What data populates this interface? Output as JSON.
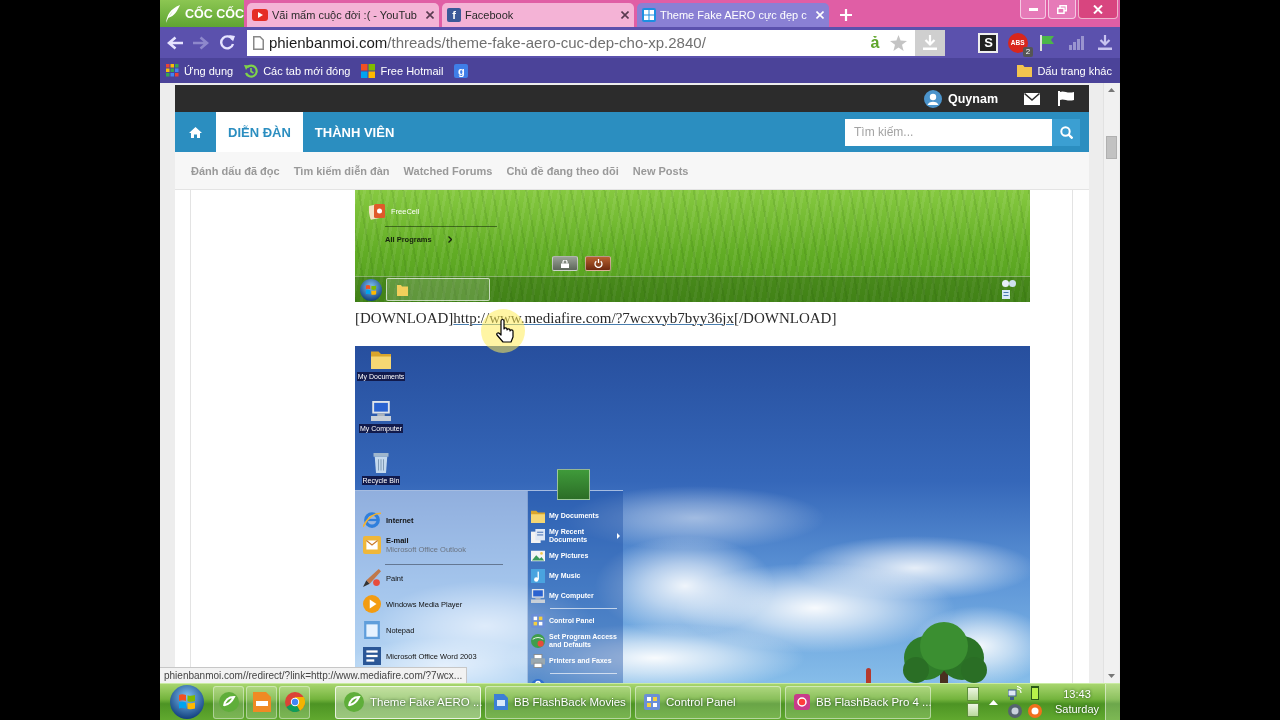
{
  "browser": {
    "logo": "CỐC CỐC",
    "tabs": [
      {
        "kind": "youtube",
        "title": "Vãi mấm cuộc đời :( - YouTub",
        "selected": false
      },
      {
        "kind": "facebook",
        "favicon": "f",
        "title": "Facebook",
        "selected": false
      },
      {
        "kind": "windows",
        "title": "Theme Fake AERO cực đẹp c",
        "selected": true
      }
    ],
    "address": {
      "domain": "phienbanmoi.com",
      "path": "/threads/theme-fake-aero-cuc-dep-cho-xp.2840/"
    },
    "typing_indicator": "ả",
    "extensions": [
      {
        "kind": "download_tile"
      },
      {
        "kind": "s_box",
        "label": "S"
      },
      {
        "kind": "abs",
        "label": "ABS",
        "badge": "2"
      },
      {
        "kind": "flag"
      },
      {
        "kind": "bars"
      },
      {
        "kind": "download"
      }
    ],
    "bookmarks": [
      {
        "kind": "apps",
        "label": "Ứng dụng"
      },
      {
        "kind": "recent",
        "label": "Các tab mới đóng"
      },
      {
        "kind": "windows",
        "label": "Free Hotmail"
      },
      {
        "kind": "google",
        "label": "g"
      }
    ],
    "other_bookmarks": "Dấu trang khác"
  },
  "forum": {
    "user": "Quynam",
    "nav_tabs": [
      {
        "kind": "home",
        "selected": false
      },
      {
        "kind": "text",
        "label": "DIỄN ĐÀN",
        "selected": true
      },
      {
        "kind": "text",
        "label": "THÀNH VIÊN",
        "selected": false
      }
    ],
    "search": {
      "placeholder": "Tìm kiếm..."
    },
    "sub_nav": [
      "Đánh dấu đã đọc",
      "Tìm kiếm diễn đàn",
      "Watched Forums",
      "Chủ đề đang theo dõi",
      "New Posts"
    ]
  },
  "post": {
    "screenshot_1": {
      "menu_items": [
        "FreeCell"
      ],
      "all_programs": "All Programs"
    },
    "download_line": {
      "prefix": "[DOWNLOAD]",
      "link": "http://www.mediafire.com/?7wcxvyb7byy36jx",
      "suffix": "[/DOWNLOAD]"
    },
    "screenshot_2": {
      "desktop_icons": [
        {
          "kind": "folder",
          "label": "My Documents"
        },
        {
          "kind": "computer",
          "label": "My Computer"
        },
        {
          "kind": "bin",
          "label": "Recycle Bin"
        }
      ],
      "start_left": [
        {
          "kind": "ie",
          "label": "Internet"
        },
        {
          "kind": "mail",
          "label": "E-mail",
          "subtitle": "Microsoft Office Outlook"
        },
        {
          "kind": "separator"
        },
        {
          "kind": "paint",
          "label": "Paint"
        },
        {
          "kind": "media",
          "label": "Windows Media Player"
        },
        {
          "kind": "notepad",
          "label": "Notepad"
        },
        {
          "kind": "word",
          "label": "Microsoft Office Word 2003"
        }
      ],
      "start_right": [
        {
          "kind": "folder",
          "label": "My Documents",
          "submenu": false
        },
        {
          "kind": "recent",
          "label": "My Recent Documents",
          "submenu": true
        },
        {
          "kind": "pictures",
          "label": "My Pictures",
          "submenu": false
        },
        {
          "kind": "music",
          "label": "My Music",
          "submenu": false
        },
        {
          "kind": "computer",
          "label": "My Computer",
          "submenu": false
        },
        {
          "kind": "separator"
        },
        {
          "kind": "control",
          "label": "Control Panel",
          "submenu": false
        },
        {
          "kind": "defaults",
          "label": "Set Program Access and Defaults",
          "submenu": false
        },
        {
          "kind": "printer",
          "label": "Printers and Faxes",
          "submenu": false
        },
        {
          "kind": "separator"
        },
        {
          "kind": "help"
        }
      ]
    }
  },
  "status_bubble": "phienbanmoi.com//redirect/?link=http://www.mediafire.com/?7wcx...",
  "taskbar": {
    "pinned": [
      {
        "kind": "coccoc"
      },
      {
        "kind": "pdf"
      },
      {
        "kind": "chrome"
      }
    ],
    "tasks": [
      {
        "kind": "coccoc",
        "label": "Theme Fake AERO ...",
        "selected": true
      },
      {
        "kind": "movies",
        "label": "BB FlashBack Movies",
        "selected": false
      },
      {
        "kind": "control",
        "label": "Control Panel",
        "selected": false
      },
      {
        "kind": "recorder",
        "label": "BB FlashBack Pro 4 ...",
        "selected": false
      }
    ],
    "clock": {
      "time": "13:43",
      "day": "Saturday"
    }
  }
}
